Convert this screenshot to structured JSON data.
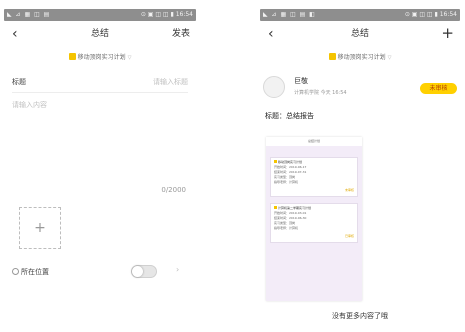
{
  "left": {
    "statusbar": {
      "left": "◣ ⊿ ▦ ◫ ▤",
      "right": "⊙ ▣ ◫ ◫ ▮ 16:54"
    },
    "nav": {
      "back": "‹",
      "title": "总结",
      "action": "发表"
    },
    "plan": {
      "label": "移动顶岗实习计划",
      "caret": "▽"
    },
    "form": {
      "title_label": "标题",
      "title_placeholder": "请输入标题",
      "content_placeholder": "请输入内容",
      "counter": "0/2000",
      "add_symbol": "+",
      "location_label": "所在位置",
      "location_arrow": "›"
    }
  },
  "right": {
    "statusbar": {
      "left": "◣ ⊿ ▦ ◫ ▤ ◧",
      "right": "⊙ ▣ ◫ ◫ ▮ 16:54"
    },
    "nav": {
      "back": "‹",
      "title": "总结",
      "action": "+"
    },
    "plan": {
      "label": "移动顶岗实习计划",
      "caret": "▽"
    },
    "post": {
      "user_name": "巨敬",
      "meta": "计算机学院   今天 16:54",
      "status": "未审核",
      "title": "标题：总结报告"
    },
    "thumbnail": {
      "header": "总结计划",
      "cards": [
        {
          "title": "移动顶岗实习计划",
          "lines": [
            "开始时间：2019-06-17",
            "结束时间：2019-07-31",
            "实习类型：顶岗",
            "指导老师：计算机"
          ],
          "status": "未审核"
        },
        {
          "title": "计算机第二学期实习计划",
          "lines": [
            "开始时间：2019-03-01",
            "结束时间：2019-06-30",
            "实习类型：顶岗",
            "指导老师：计算机"
          ],
          "status": "已审核"
        }
      ]
    },
    "footer": "没有更多内容了哦"
  },
  "colors": {
    "accent_yellow": "#ffd000",
    "status_text": "#b33b00",
    "statusbar": "#8e8e8e"
  }
}
